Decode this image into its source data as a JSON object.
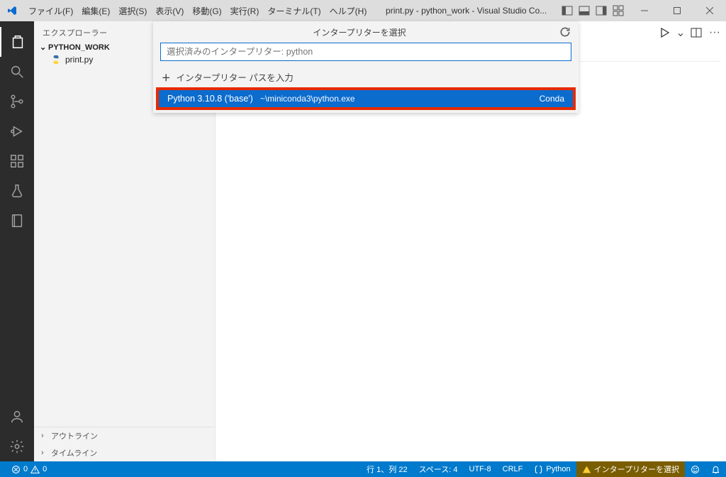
{
  "titlebar": {
    "menus": [
      "ファイル(F)",
      "編集(E)",
      "選択(S)",
      "表示(V)",
      "移動(G)",
      "実行(R)",
      "ターミナル(T)",
      "ヘルプ(H)"
    ],
    "title": "print.py - python_work - Visual Studio Co..."
  },
  "sidebar": {
    "title": "エクスプローラー",
    "folder": "PYTHON_WORK",
    "file": "print.py",
    "outline": "アウトライン",
    "timeline": "タイムライン"
  },
  "dropdown": {
    "title": "インタープリターを選択",
    "placeholder": "選択済みのインタープリター: python",
    "enter_path": "インタープリター パスを入力",
    "selected": {
      "label": "Python 3.10.8 ('base')",
      "path": "~\\miniconda3\\python.exe",
      "tag": "Conda"
    }
  },
  "statusbar": {
    "errors": "0",
    "warnings": "0",
    "cursor": "行 1、列 22",
    "spaces": "スペース: 4",
    "encoding": "UTF-8",
    "eol": "CRLF",
    "lang": "Python",
    "interpreter": "インタープリターを選択"
  }
}
